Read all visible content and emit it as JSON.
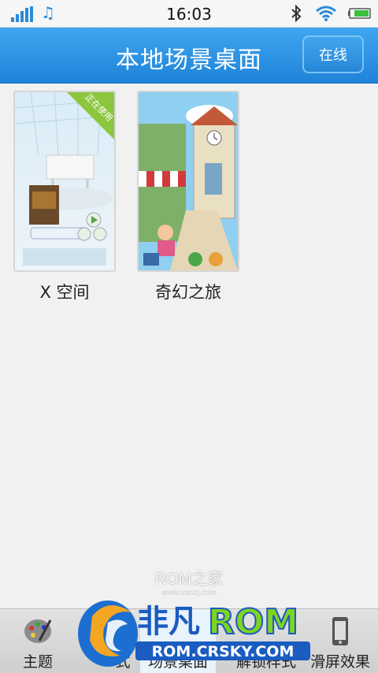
{
  "status_bar": {
    "time": "16:03",
    "icons": [
      "signal-icon",
      "music-note-icon",
      "bluetooth-icon",
      "wifi-icon",
      "battery-icon"
    ]
  },
  "header": {
    "title": "本地场景桌面",
    "online_button": "在线"
  },
  "themes": [
    {
      "name": "X 空间",
      "badge": "正在使用"
    },
    {
      "name": "奇幻之旅"
    }
  ],
  "watermark": {
    "main": "ROM之家",
    "sub": "www.romzj.com"
  },
  "tabs": [
    {
      "label": "主题",
      "icon": "palette-icon"
    },
    {
      "label": "式",
      "icon": "style-icon"
    },
    {
      "label": "场景桌面",
      "icon": "scene-icon"
    },
    {
      "label": "解锁样式",
      "icon": "lock-icon"
    },
    {
      "label": "滑屏效果",
      "icon": "phone-icon"
    }
  ],
  "logo": {
    "text_cn": "非凡",
    "text_rom": "ROM",
    "url_text": "ROM.CRSKY.COM"
  },
  "colors": {
    "accent": "#2a8ee0",
    "rom_green": "#7fd321",
    "badge_green": "#8cc63f"
  }
}
